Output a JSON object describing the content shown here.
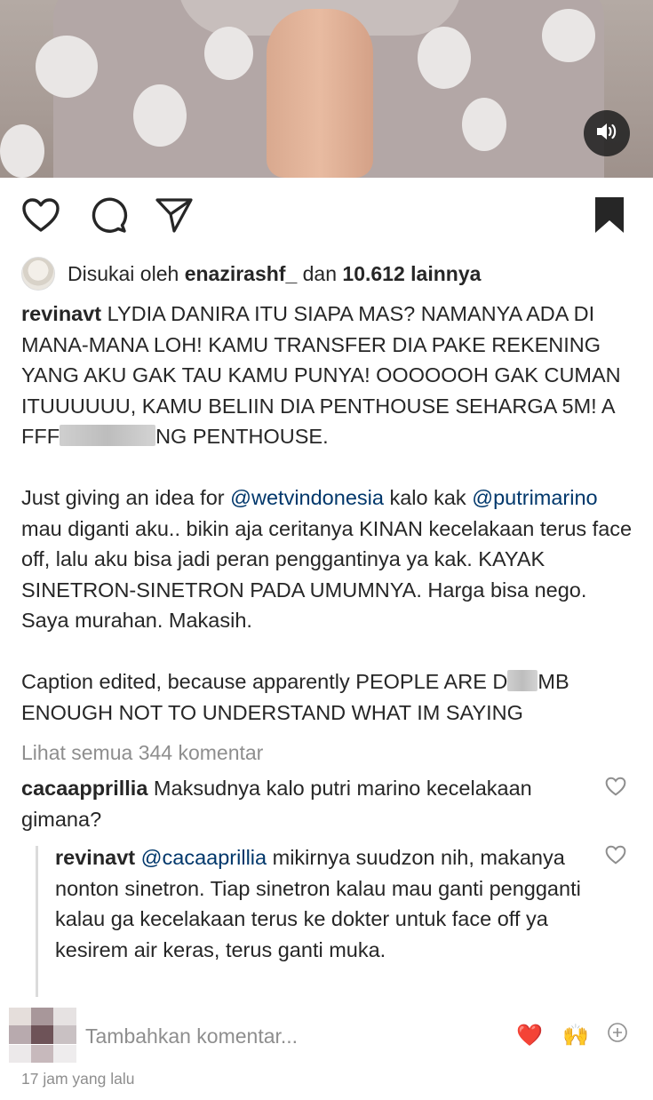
{
  "post": {
    "media": {
      "type": "video",
      "sound_icon": "speaker-icon"
    },
    "actions": {
      "like_icon": "heart-icon",
      "comment_icon": "comment-icon",
      "share_icon": "send-icon",
      "save_icon": "bookmark-icon"
    },
    "likes": {
      "prefix": "Disukai oleh",
      "user": "enazirashf_",
      "connector": "dan",
      "count": "10.612 lainnya"
    },
    "caption": {
      "username": "revinavt",
      "p1": "LYDIA DANIRA ITU SIAPA MAS? NAMANYA ADA DI MANA-MANA LOH! KAMU TRANSFER DIA PAKE REKENING YANG AKU GAK TAU KAMU PUNYA! OOOOOOH GAK CUMAN ITUUUUUU, KAMU BELIIN DIA PENTHOUSE SEHARGA 5M! A FFF",
      "p1_end": "NG PENTHOUSE.",
      "p2_a": "Just giving an idea for",
      "mention1": "@wetvindonesia",
      "p2_b": "kalo kak",
      "mention2": "@putrimarino",
      "p2_c": "mau diganti aku.. bikin aja ceritanya KINAN kecelakaan terus face off, lalu aku bisa jadi peran penggantinya ya kak. KAYAK SINETRON-SINETRON PADA UMUMNYA. Harga bisa nego. Saya murahan. Makasih.",
      "p3_a": "Caption edited, because apparently PEOPLE ARE D",
      "p3_b": "MB",
      "p3_c": "ENOUGH NOT TO UNDERSTAND WHAT IM SAYING"
    },
    "view_all_comments": "Lihat semua 344 komentar",
    "comments": [
      {
        "username": "cacaapprillia",
        "text": "Maksudnya kalo putri marino kecelakaan gimana?",
        "like_icon": "heart-outline-icon"
      }
    ],
    "reply": {
      "username": "revinavt",
      "mention": "@cacaaprillia",
      "text": "mikirnya suudzon nih, makanya nonton sinetron. Tiap sinetron kalau mau ganti pengganti kalau ga kecelakaan terus ke dokter untuk face off ya kesirem air keras, terus ganti muka.",
      "like_icon": "heart-outline-icon"
    },
    "add_comment": {
      "placeholder": "Tambahkan komentar...",
      "quick_emojis": [
        "❤️",
        "🙌"
      ],
      "more_icon": "plus-circle-icon"
    },
    "timestamp": "17 jam yang lalu"
  }
}
